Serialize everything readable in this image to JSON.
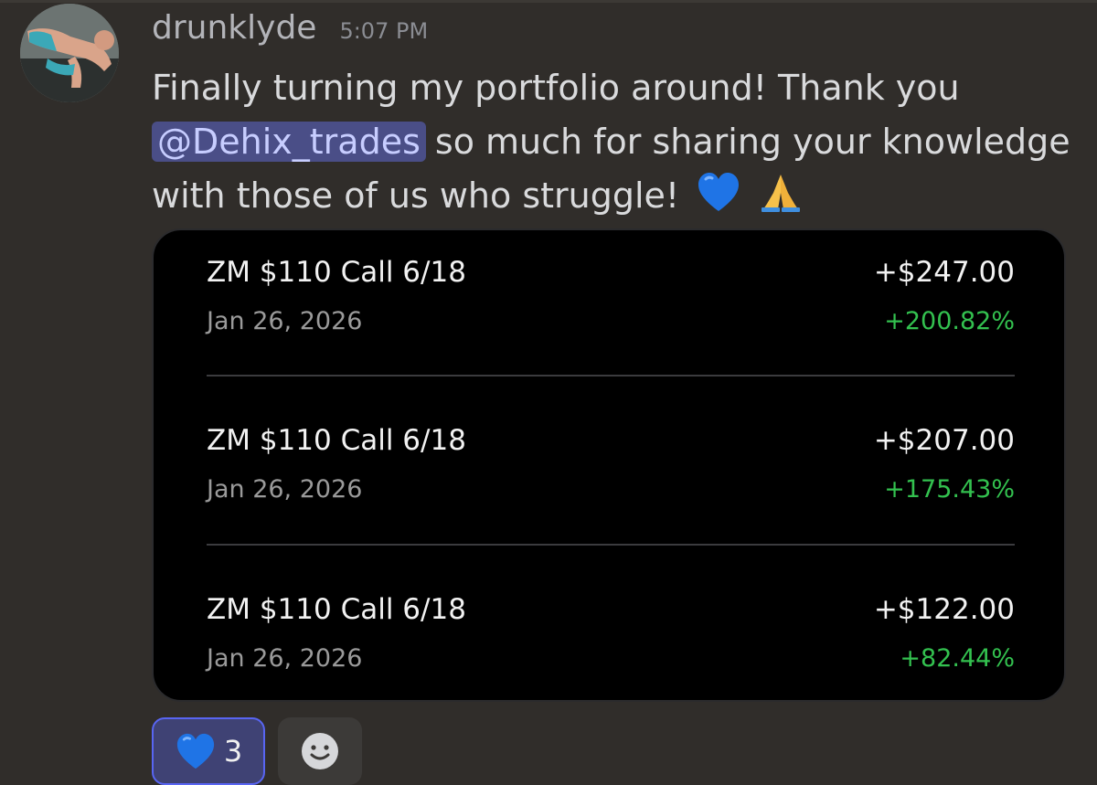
{
  "message": {
    "username": "drunklyde",
    "timestamp": "5:07 PM",
    "text_line1": "Finally turning my portfolio around! Thank you",
    "mention": "@Dehix_trades",
    "text_line2_rest": "so much for sharing your knowledge",
    "text_line3": "with those of us who struggle!",
    "emojis": [
      "blue-heart-icon",
      "folded-hands-icon"
    ]
  },
  "trades": [
    {
      "symbol": "ZM $110 Call 6/18",
      "date": "Jan 26, 2026",
      "pnl": "+$247.00",
      "pct": "+200.82%"
    },
    {
      "symbol": "ZM $110 Call 6/18",
      "date": "Jan 26, 2026",
      "pnl": "+$207.00",
      "pct": "+175.43%"
    },
    {
      "symbol": "ZM $110 Call 6/18",
      "date": "Jan 26, 2026",
      "pnl": "+$122.00",
      "pct": "+82.44%"
    }
  ],
  "reactions": [
    {
      "emoji": "blue-heart-icon",
      "count": "3",
      "active": true
    }
  ],
  "add_reaction_icon": "smiley-face-icon",
  "colors": {
    "background": "#302d2a",
    "card": "#000000",
    "gain": "#33c14f",
    "mention_bg": "#4a4e87",
    "reaction_active_bg": "#3f4274",
    "reaction_active_border": "#5865f2"
  }
}
